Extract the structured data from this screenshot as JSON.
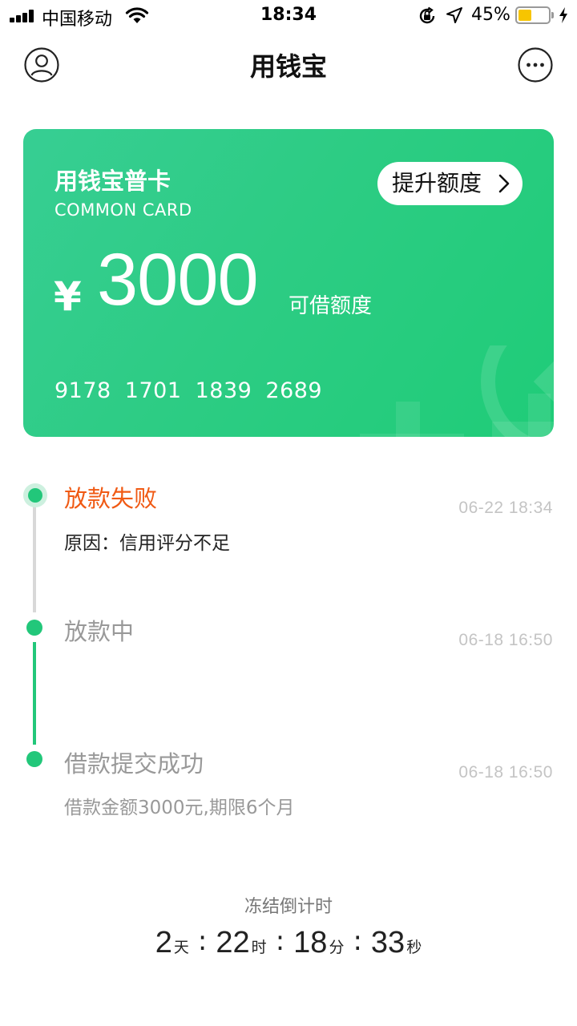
{
  "status_bar": {
    "carrier": "中国移动",
    "time": "18:34",
    "battery_percent": "45%",
    "battery_level": 0.45
  },
  "nav": {
    "title": "用钱宝",
    "left_icon": "profile-icon",
    "right_icon": "more-icon"
  },
  "card": {
    "title": "用钱宝普卡",
    "subtitle": "COMMON CARD",
    "upgrade_label": "提升额度",
    "currency": "¥",
    "amount": "3000",
    "amount_label": "可借额度",
    "card_number": "9178 1701 1839 2689",
    "gradient_start": "#37ce93",
    "gradient_end": "#1fcc78"
  },
  "timeline": [
    {
      "status": "放款失败",
      "time": "06-22 18:34",
      "detail": "原因：信用评分不足",
      "color": "#f05a14",
      "detail_color": "#222222",
      "active": true
    },
    {
      "status": "放款中",
      "time": "06-18 16:50",
      "detail": "",
      "color": "#999999",
      "active": false
    },
    {
      "status": "借款提交成功",
      "time": "06-18 16:50",
      "detail": "借款金额3000元,期限6个月",
      "color": "#999999",
      "detail_color": "#999999",
      "active": false
    }
  ],
  "countdown": {
    "label": "冻结倒计时",
    "days": "2",
    "days_unit": "天",
    "hours": "22",
    "hours_unit": "时",
    "minutes": "18",
    "minutes_unit": "分",
    "seconds": "33",
    "seconds_unit": "秒",
    "separator": ":"
  },
  "colors": {
    "accent_green": "#22c77a",
    "error_orange": "#f05a14",
    "muted_gray": "#999999"
  }
}
